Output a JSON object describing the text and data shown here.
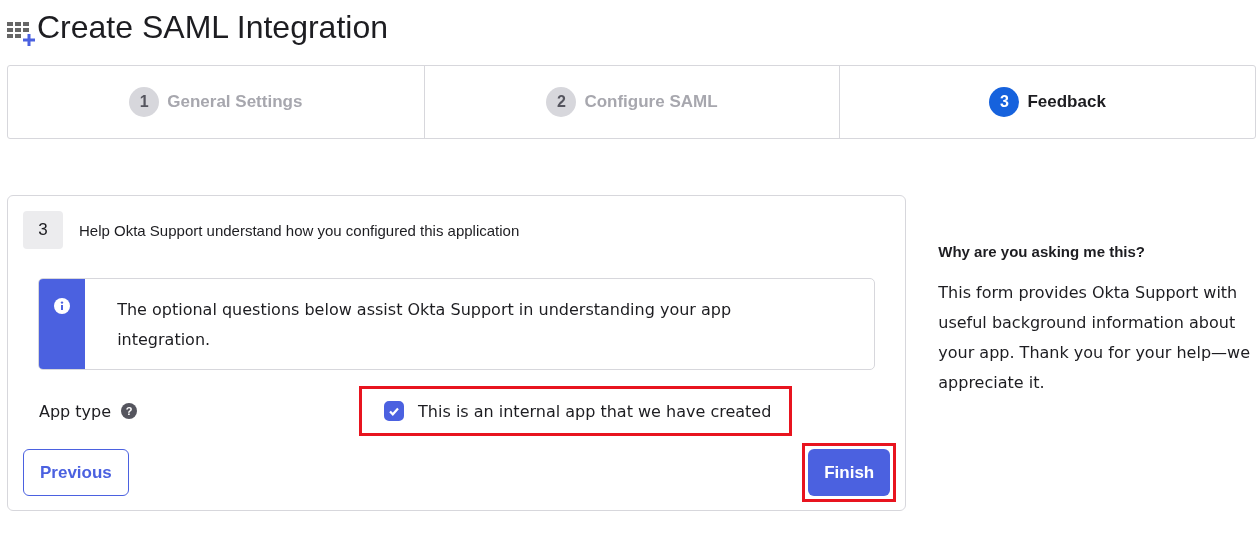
{
  "title": "Create SAML Integration",
  "steps": [
    {
      "number": "1",
      "label": "General Settings",
      "selected": false
    },
    {
      "number": "2",
      "label": "Configure SAML",
      "selected": false
    },
    {
      "number": "3",
      "label": "Feedback",
      "selected": true
    }
  ],
  "section": {
    "number": "3",
    "heading": "Help Okta Support understand how you configured this application",
    "info": "The optional questions below assist Okta Support in understanding your app integration.",
    "field_label": "App type",
    "help_mark": "?",
    "checkbox": {
      "label": "This is an internal app that we have created",
      "checked": true,
      "highlighted": true
    },
    "buttons": [
      {
        "label": "Previous",
        "kind": "secondary",
        "highlighted": false
      },
      {
        "label": "Finish",
        "kind": "primary",
        "highlighted": true
      }
    ]
  },
  "aside": {
    "heading": "Why are you asking me this?",
    "text": "This form provides Okta Support with useful background information about your app. Thank you for your help—we appreciate it."
  }
}
